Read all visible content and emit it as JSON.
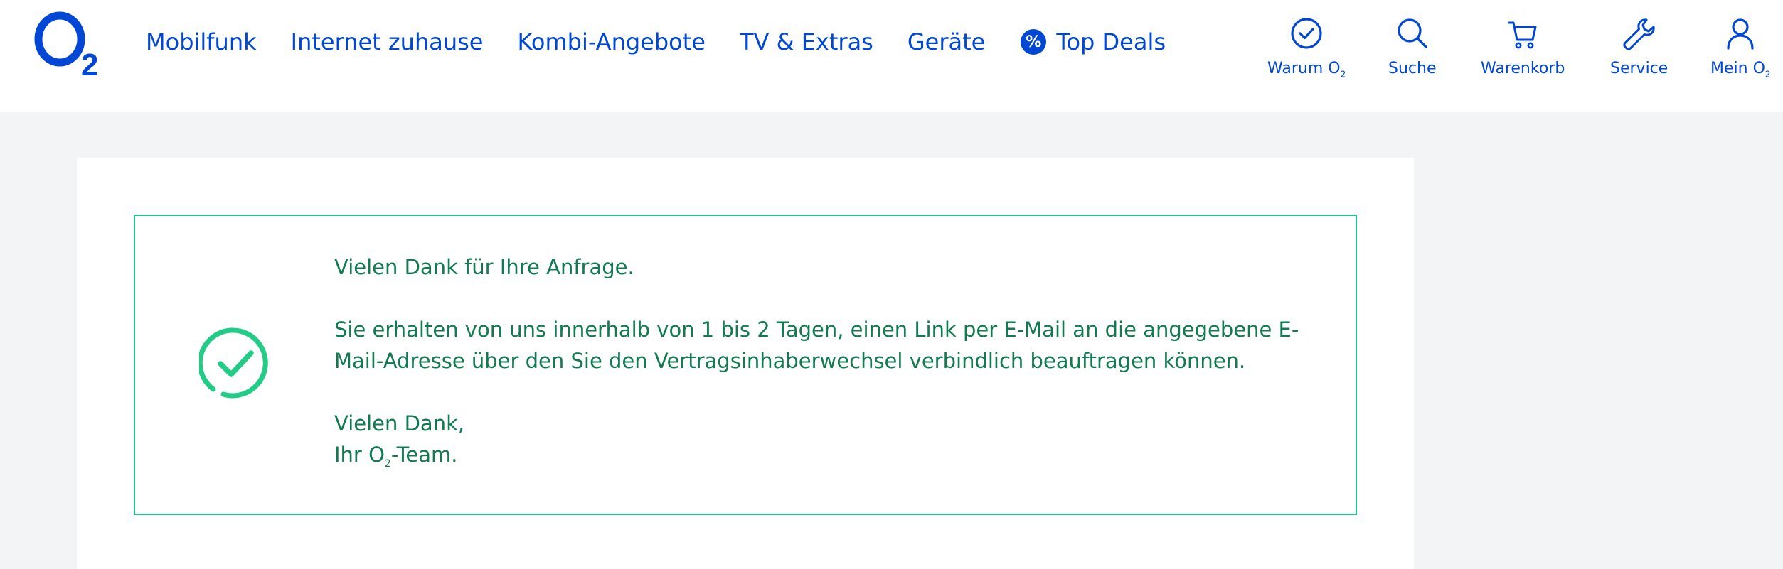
{
  "header": {
    "logo_text": "O2",
    "nav": [
      {
        "label": "Mobilfunk"
      },
      {
        "label": "Internet zuhause"
      },
      {
        "label": "Kombi-Angebote"
      },
      {
        "label": "TV & Extras"
      },
      {
        "label": "Geräte"
      },
      {
        "label": "Top Deals",
        "badge": "%"
      }
    ],
    "utility": {
      "warum": {
        "label": "Warum O",
        "sub": "2",
        "icon": "check-circle-icon"
      },
      "suche": {
        "label": "Suche",
        "icon": "search-icon"
      },
      "warenkorb": {
        "label": "Warenkorb",
        "icon": "cart-icon"
      },
      "service": {
        "label": "Service",
        "icon": "wrench-icon"
      },
      "mein": {
        "label": "Mein O",
        "sub": "2",
        "icon": "user-icon"
      }
    }
  },
  "message": {
    "icon": "success-check-icon",
    "line1": "Vielen Dank für Ihre Anfrage.",
    "line2": "Sie erhalten von uns innerhalb von 1 bis 2 Tagen, einen Link per E-Mail an die angegebene E-Mail-Adresse über den Sie den Vertragsinhaberwechsel verbindlich beauftragen können.",
    "closing": "Vielen Dank,",
    "team_prefix": "Ihr O",
    "team_sub": "2",
    "team_suffix": "-Team."
  },
  "colors": {
    "brand_blue": "#0047d6",
    "success_green": "#22c08a",
    "text_green": "#117a50",
    "background": "#f3f4f6"
  }
}
